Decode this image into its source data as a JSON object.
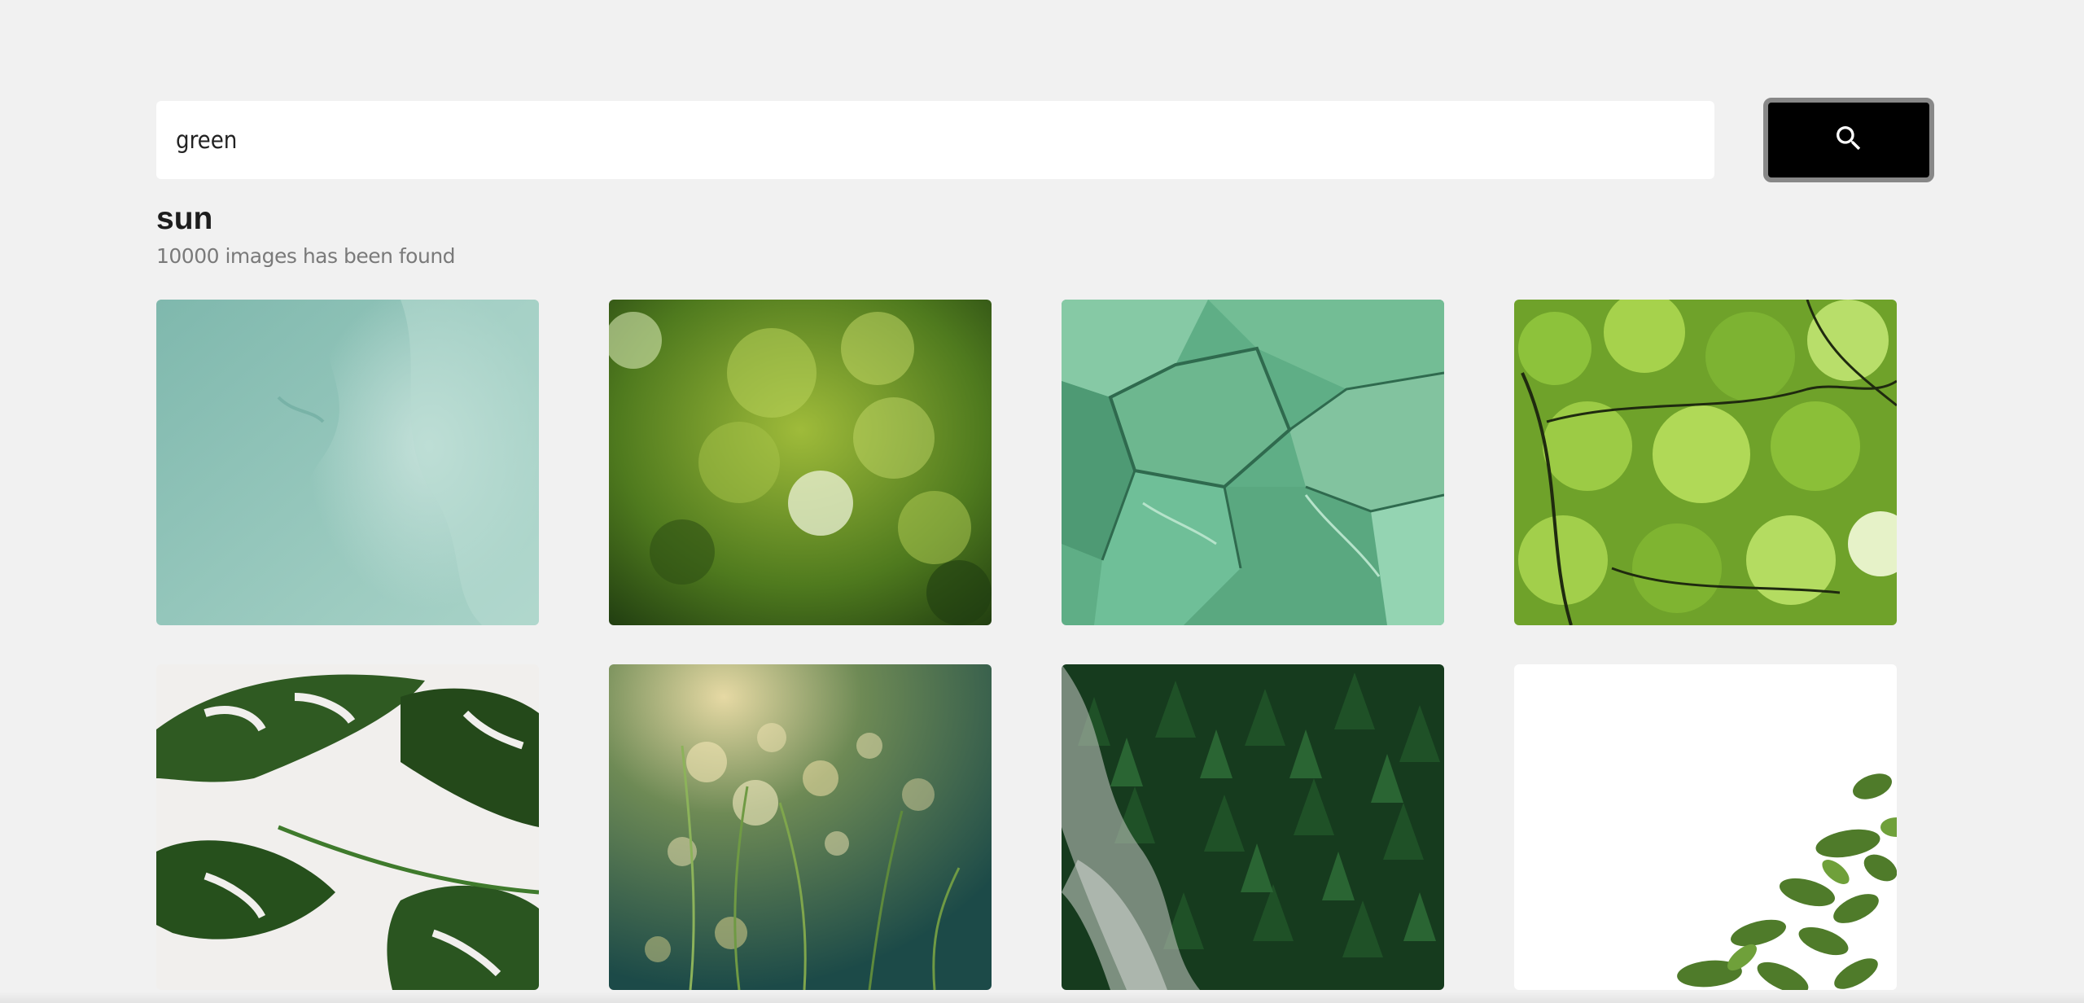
{
  "search": {
    "value": "green",
    "button_icon": "search-icon"
  },
  "results": {
    "title": "sun",
    "count_text": "10000 images has been found"
  },
  "images": [
    {
      "subject": "teal-texture"
    },
    {
      "subject": "green-bokeh"
    },
    {
      "subject": "green-marble"
    },
    {
      "subject": "green-leaves-canopy"
    },
    {
      "subject": "monstera-leaves"
    },
    {
      "subject": "dewy-grass-bokeh"
    },
    {
      "subject": "misty-pine-forest"
    },
    {
      "subject": "plant-on-white"
    }
  ],
  "colors": {
    "background": "#f1f1f1",
    "button": "#000000",
    "button_border": "#888888"
  }
}
